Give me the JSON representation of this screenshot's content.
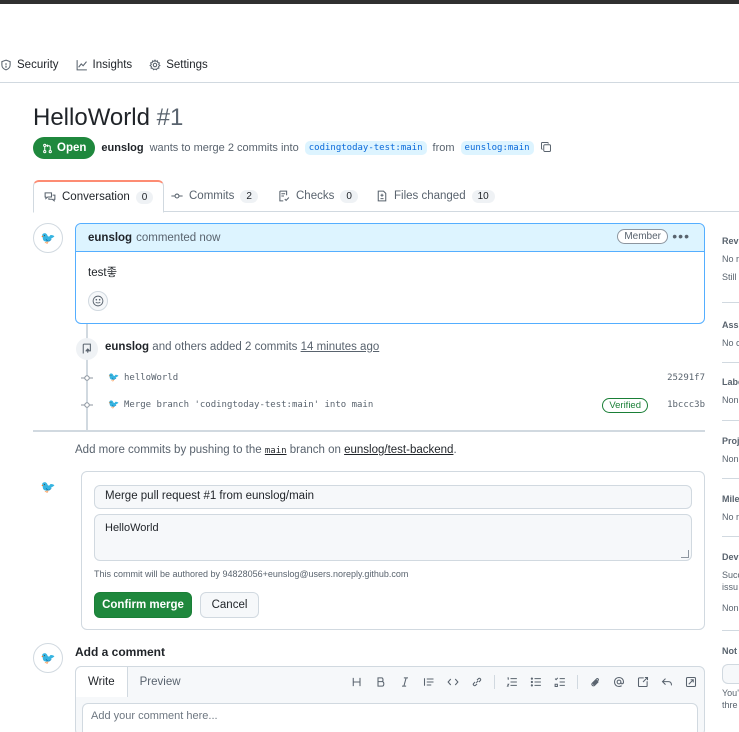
{
  "repo_nav": {
    "items": [
      {
        "label": "Security",
        "icon": "shield-icon"
      },
      {
        "label": "Insights",
        "icon": "graph-icon"
      },
      {
        "label": "Settings",
        "icon": "gear-icon"
      }
    ]
  },
  "pr": {
    "title": "HelloWorld",
    "number": "#1",
    "state": "Open",
    "author": "eunslog",
    "merge_text": "wants to merge 2 commits into",
    "base_branch": "codingtoday-test:main",
    "from_text": "from",
    "head_branch": "eunslog:main"
  },
  "tabs": [
    {
      "label": "Conversation",
      "count": "0",
      "icon": "comment-discussion-icon"
    },
    {
      "label": "Commits",
      "count": "2",
      "icon": "git-commit-icon"
    },
    {
      "label": "Checks",
      "count": "0",
      "icon": "checklist-icon"
    },
    {
      "label": "Files changed",
      "count": "10",
      "icon": "file-diff-icon"
    }
  ],
  "comment": {
    "author": "eunslog",
    "action": "commented now",
    "role": "Member",
    "body": "test좋"
  },
  "commit_event": {
    "author": "eunslog",
    "text": "and others added 2 commits",
    "time": "14 minutes ago",
    "commits": [
      {
        "message": "helloWorld",
        "sha": "25291f7",
        "verified": ""
      },
      {
        "message": "Merge branch 'codingtoday-test:main' into main",
        "sha": "1bccc3b",
        "verified": "Verified"
      }
    ]
  },
  "push_hint": {
    "prefix": "Add more commits by pushing to the",
    "branch": "main",
    "middle": "branch on",
    "repo": "eunslog/test-backend",
    "suffix": "."
  },
  "merge": {
    "title": "Merge pull request #1 from eunslog/main",
    "message": "HelloWorld",
    "author_note": "This commit will be authored by 94828056+eunslog@users.noreply.github.com",
    "confirm_label": "Confirm merge",
    "cancel_label": "Cancel"
  },
  "new_comment": {
    "title": "Add a comment",
    "write_tab": "Write",
    "preview_tab": "Preview",
    "placeholder": "Add your comment here..."
  },
  "sidebar": {
    "sections": [
      {
        "heading": "Revi",
        "lines": [
          "No r",
          "Still"
        ]
      },
      {
        "heading": "Assi",
        "lines": [
          "No c"
        ]
      },
      {
        "heading": "Labe",
        "lines": [
          "Non"
        ]
      },
      {
        "heading": "Proj",
        "lines": [
          "Non"
        ]
      },
      {
        "heading": "Mile",
        "lines": [
          "No r"
        ]
      },
      {
        "heading": "Dev",
        "lines": [
          "Succ",
          "issu",
          "Non"
        ]
      },
      {
        "heading": "Not",
        "lines": [
          "You'",
          "thre"
        ]
      }
    ]
  },
  "colors": {
    "open_green": "#1f883d",
    "accent_blue": "#0969da",
    "tab_underline": "#fd8c73",
    "comment_header": "#ddf4ff"
  }
}
